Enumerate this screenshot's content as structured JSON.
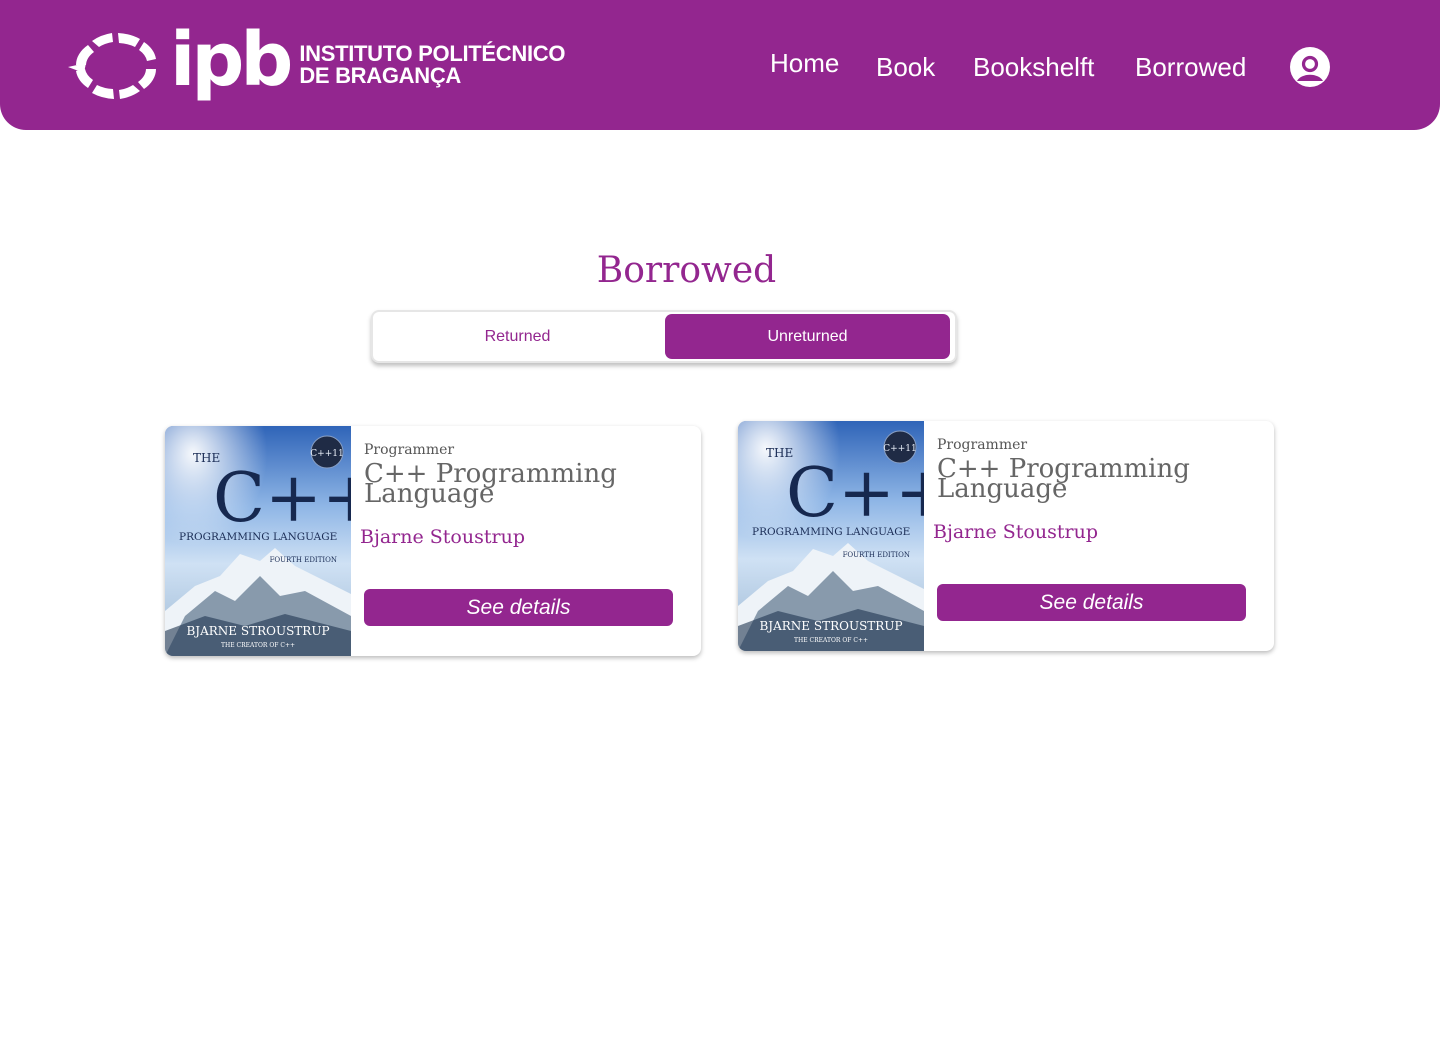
{
  "brand": {
    "logo_text": "ipb",
    "name_line1": "INSTITUTO POLITÉCNICO",
    "name_line2": "DE BRAGANÇA"
  },
  "nav": {
    "items": [
      {
        "label": "Home"
      },
      {
        "label": "Book"
      },
      {
        "label": "Bookshelft"
      },
      {
        "label": "Borrowed"
      }
    ],
    "profile_icon": "user-circle-icon"
  },
  "page": {
    "title": "Borrowed"
  },
  "toggle": {
    "returned_label": "Returned",
    "unreturned_label": "Unreturned",
    "selected": "Unreturned"
  },
  "books": [
    {
      "category": "Programmer",
      "title": "C++ Programming Language",
      "author": "Bjarne Stoustrup",
      "button_label": "See details",
      "cover": {
        "line1": "THE",
        "big": "C++",
        "badge": "C++11",
        "subtitle": "PROGRAMMING LANGUAGE",
        "edition": "FOURTH EDITION",
        "author": "BJARNE STROUSTRUP",
        "tagline": "THE CREATOR OF C++"
      }
    },
    {
      "category": "Programmer",
      "title": "C++ Programming Language",
      "author": "Bjarne Stoustrup",
      "button_label": "See details",
      "cover": {
        "line1": "THE",
        "big": "C++",
        "badge": "C++11",
        "subtitle": "PROGRAMMING LANGUAGE",
        "edition": "FOURTH EDITION",
        "author": "BJARNE STROUSTRUP",
        "tagline": "THE CREATOR OF C++"
      }
    }
  ],
  "colors": {
    "brand": "#93268f",
    "text_gray": "#666666"
  }
}
